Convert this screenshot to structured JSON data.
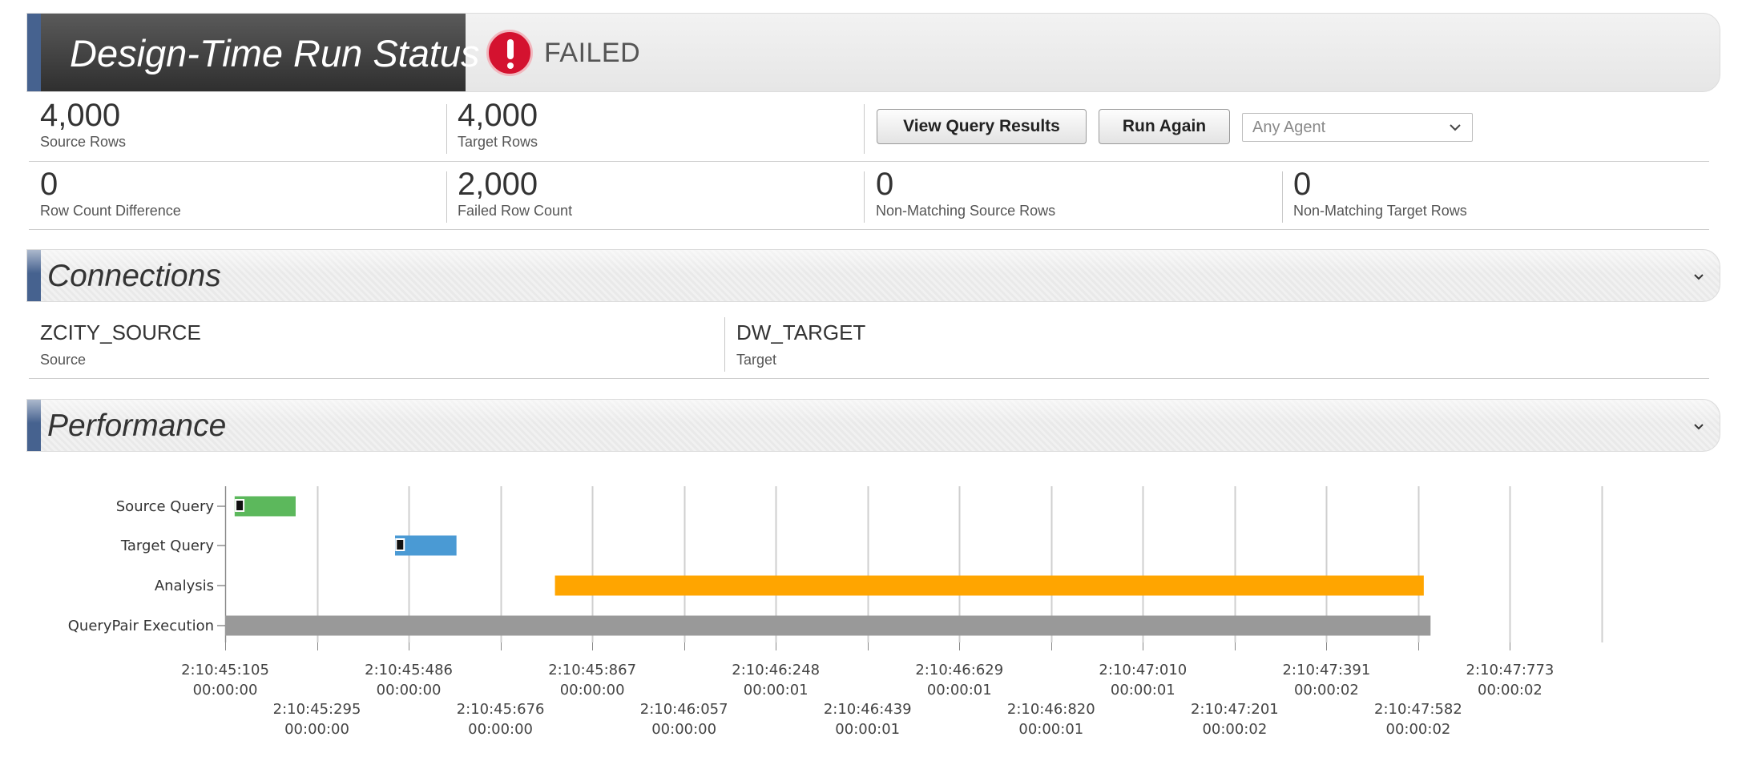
{
  "status": {
    "title": "Design-Time Run Status",
    "state": "FAILED",
    "state_color": "#d4122f"
  },
  "stats": {
    "source_rows": {
      "value": "4,000",
      "label": "Source Rows"
    },
    "target_rows": {
      "value": "4,000",
      "label": "Target Rows"
    },
    "row_count_difference": {
      "value": "0",
      "label": "Row Count Difference"
    },
    "failed_row_count": {
      "value": "2,000",
      "label": "Failed Row Count"
    },
    "non_matching_source_rows": {
      "value": "0",
      "label": "Non-Matching Source Rows"
    },
    "non_matching_target_rows": {
      "value": "0",
      "label": "Non-Matching Target Rows"
    }
  },
  "actions": {
    "view_query_results": "View Query Results",
    "run_again": "Run Again",
    "agent_select": {
      "selected": "Any Agent"
    }
  },
  "connections": {
    "title": "Connections",
    "source": {
      "name": "ZCITY_SOURCE",
      "label": "Source"
    },
    "target": {
      "name": "DW_TARGET",
      "label": "Target"
    }
  },
  "performance": {
    "title": "Performance"
  },
  "chart_data": {
    "type": "gantt",
    "categories": [
      "Source Query",
      "Target Query",
      "Analysis",
      "QueryPair Execution"
    ],
    "series": [
      {
        "name": "Source Query",
        "start_ms": 21,
        "end_ms": 156,
        "marker_ms": 41,
        "color": "#5cb85c"
      },
      {
        "name": "Target Query",
        "start_ms": 376,
        "end_ms": 512,
        "marker_ms": 396,
        "color": "#4a9ad4"
      },
      {
        "name": "Analysis",
        "start_ms": 730,
        "end_ms": 2653,
        "color": "#ffa500"
      },
      {
        "name": "QueryPair Execution",
        "start_ms": 0,
        "end_ms": 2668,
        "color": "#999999"
      }
    ],
    "x_start_ms": 0,
    "x_end_ms": 3047,
    "tick_labels": [
      {
        "time": "2:10:45:105",
        "elapsed": "00:00:00"
      },
      {
        "time": "2:10:45:295",
        "elapsed": "00:00:00"
      },
      {
        "time": "2:10:45:486",
        "elapsed": "00:00:00"
      },
      {
        "time": "2:10:45:676",
        "elapsed": "00:00:00"
      },
      {
        "time": "2:10:45:867",
        "elapsed": "00:00:00"
      },
      {
        "time": "2:10:46:057",
        "elapsed": "00:00:00"
      },
      {
        "time": "2:10:46:248",
        "elapsed": "00:00:01"
      },
      {
        "time": "2:10:46:439",
        "elapsed": "00:00:01"
      },
      {
        "time": "2:10:46:629",
        "elapsed": "00:00:01"
      },
      {
        "time": "2:10:46:820",
        "elapsed": "00:00:01"
      },
      {
        "time": "2:10:47:010",
        "elapsed": "00:00:01"
      },
      {
        "time": "2:10:47:201",
        "elapsed": "00:00:02"
      },
      {
        "time": "2:10:47:391",
        "elapsed": "00:00:02"
      },
      {
        "time": "2:10:47:582",
        "elapsed": "00:00:02"
      },
      {
        "time": "2:10:47:773",
        "elapsed": "00:00:02"
      }
    ],
    "grid": true
  }
}
